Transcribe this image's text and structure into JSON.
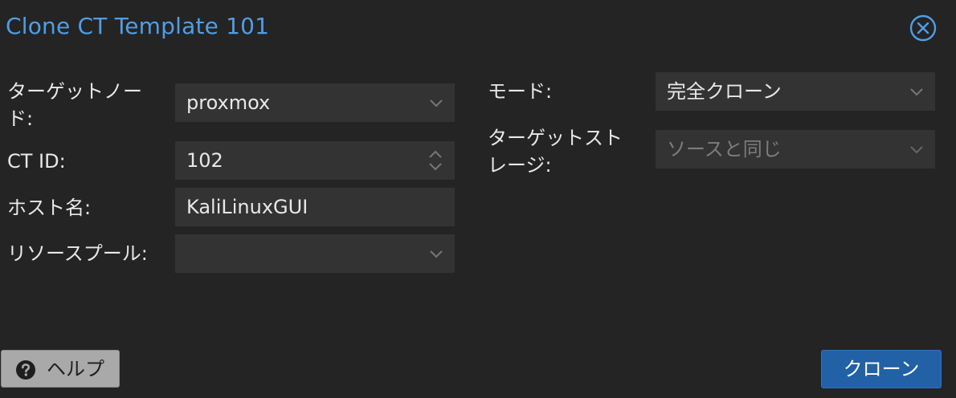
{
  "dialog": {
    "title": "Clone CT Template 101",
    "close_icon": "circle-x-icon"
  },
  "form_left": {
    "target_node": {
      "label_line1": "ターゲットノー",
      "label_line2": "ド:",
      "value": "proxmox"
    },
    "ct_id": {
      "label": "CT ID:",
      "value": "102"
    },
    "hostname": {
      "label": "ホスト名:",
      "value": "KaliLinuxGUI"
    },
    "resource_pool": {
      "label": "リソースプール:",
      "value": ""
    }
  },
  "form_right": {
    "mode": {
      "label": "モード:",
      "value": "完全クローン"
    },
    "target_storage": {
      "label_line1": "ターゲットスト",
      "label_line2": "レージ:",
      "placeholder": "ソースと同じ"
    }
  },
  "footer": {
    "help_label": "ヘルプ",
    "help_icon": "question-circle-icon",
    "clone_label": "クローン"
  },
  "colors": {
    "accent": "#4f9ee6",
    "primary_button": "#2361a6",
    "background": "#242424",
    "field_background": "#333333"
  }
}
